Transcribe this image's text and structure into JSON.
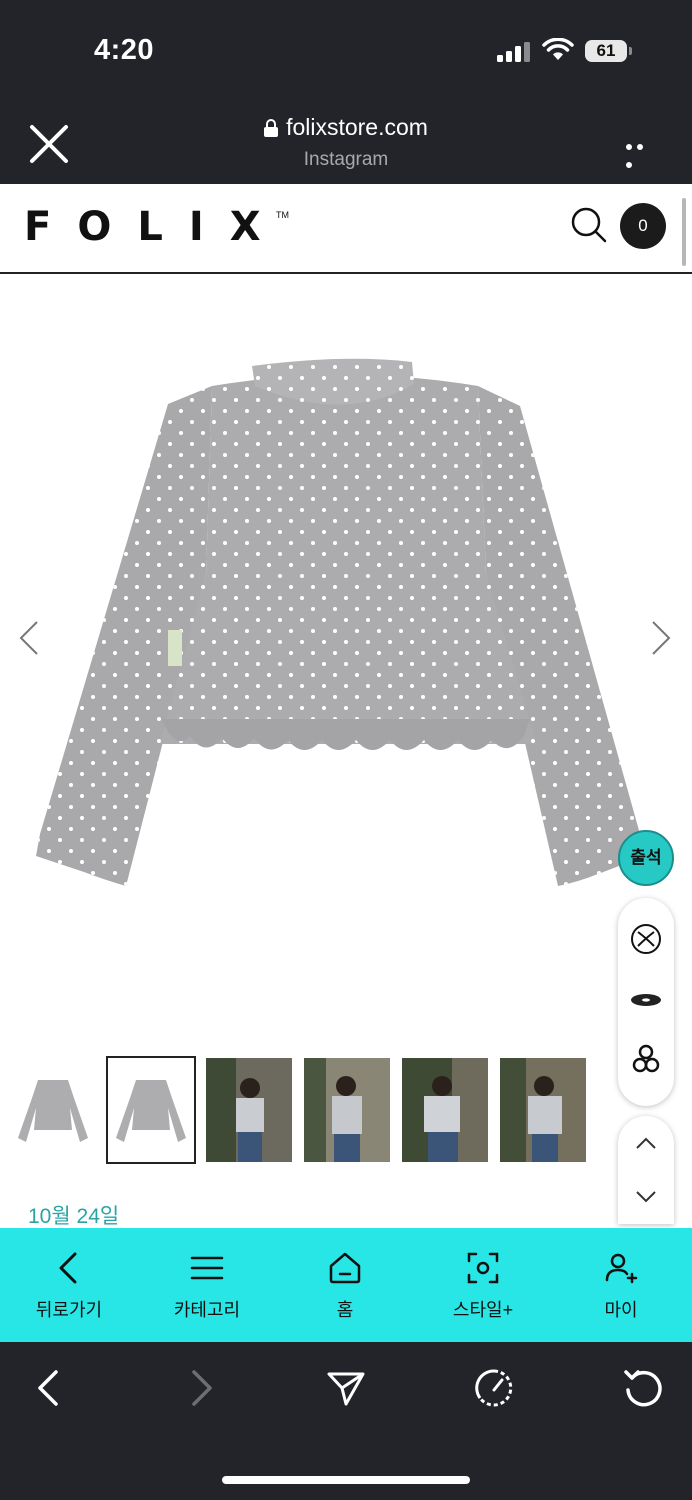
{
  "status": {
    "time": "4:20",
    "battery": "61"
  },
  "browser": {
    "url": "folixstore.com",
    "source": "Instagram"
  },
  "site": {
    "logo": "FOLIX",
    "trademark": "TM",
    "cart_count": "0"
  },
  "floating": {
    "attendance_label": "출석"
  },
  "thumbnails": [
    {
      "type": "product-front"
    },
    {
      "type": "product-back",
      "selected": true
    },
    {
      "type": "model-photo"
    },
    {
      "type": "model-photo"
    },
    {
      "type": "model-photo"
    },
    {
      "type": "model-photo"
    }
  ],
  "date_text": "10월 24일",
  "bottom_nav": [
    {
      "label": "뒤로가기",
      "icon": "chevron-left-icon"
    },
    {
      "label": "카테고리",
      "icon": "menu-icon"
    },
    {
      "label": "홈",
      "icon": "home-icon"
    },
    {
      "label": "스타일+",
      "icon": "scan-icon"
    },
    {
      "label": "마이",
      "icon": "user-add-icon"
    }
  ],
  "colors": {
    "nav_bg": "#29e6e6",
    "dark_bar": "#23242a",
    "accent": "#27c9c5"
  }
}
